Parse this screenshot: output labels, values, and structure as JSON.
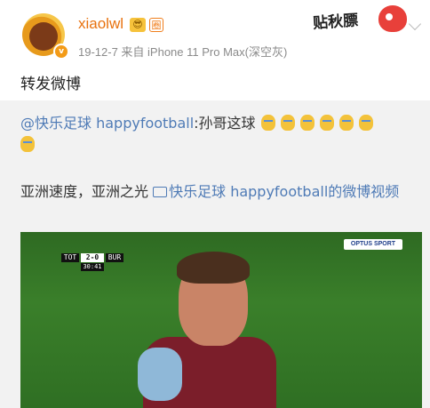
{
  "post": {
    "username": "xiaolwl",
    "badge_vip": "😎",
    "badge_circle": "圈",
    "verified_mark": "v",
    "meta": "19-12-7  来自 iPhone 11 Pro Max(深空灰)",
    "sticker_text": "贴秋膘",
    "text": "转发微博"
  },
  "repost": {
    "mention": "@快乐足球 happyfootball",
    "text": ":孙哥这球",
    "line2_text": "亚洲速度，亚洲之光",
    "line2_link": "快乐足球 happyfootball的微博视频",
    "emoji_count_line1": 6,
    "emoji_count_line2": 1
  },
  "video": {
    "home": "TOT",
    "away": "BUR",
    "score": "2-0",
    "time": "30:41",
    "broadcaster": "OPTUS SPORT"
  },
  "icons": {
    "chevron": "chevron-down-icon",
    "video_link": "video-icon",
    "emoji": "crying-emoji-icon"
  },
  "colors": {
    "username": "#e8720f",
    "link": "#4f7bb6",
    "repost_bg": "#f2f2f2"
  }
}
